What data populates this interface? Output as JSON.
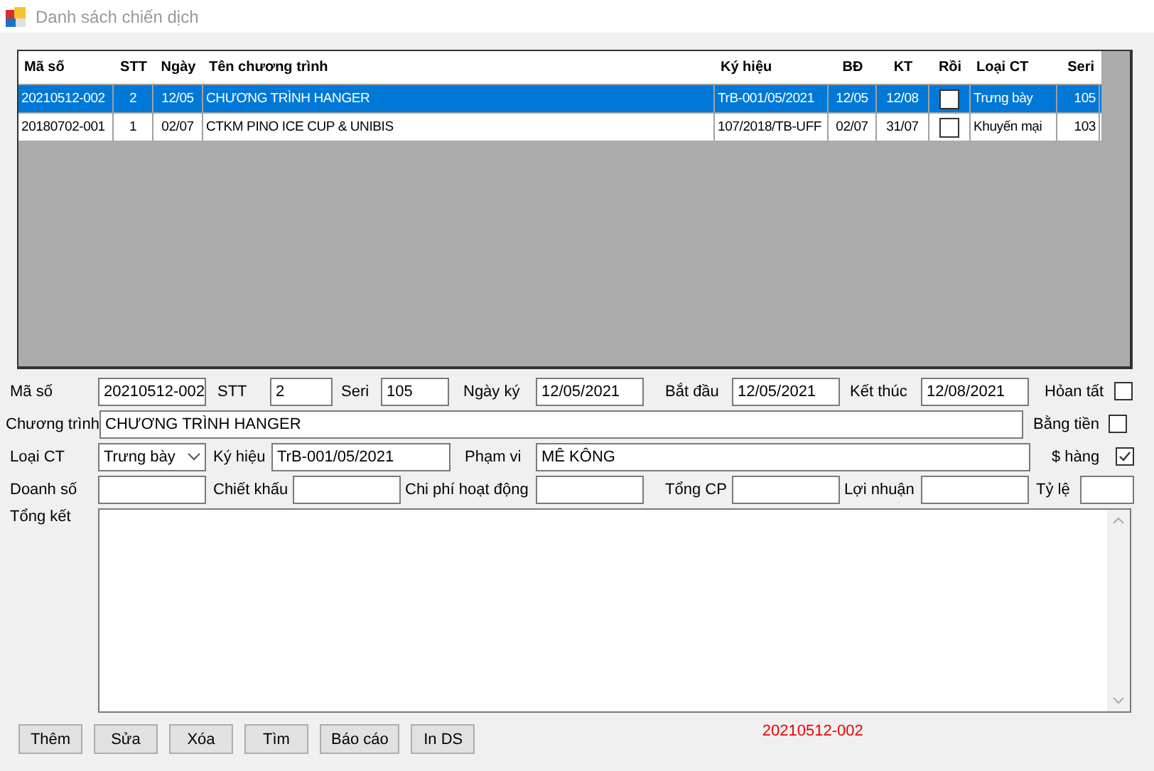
{
  "window": {
    "title": "Danh sách chiến dịch"
  },
  "table": {
    "columns": [
      "Mã số",
      "STT",
      "Ngày",
      "Tên chương trình",
      "Ký hiệu",
      "BĐ",
      "KT",
      "Rồi",
      "Loại CT",
      "Seri"
    ],
    "rows": [
      {
        "selected": true,
        "cells": [
          "20210512-002",
          "2",
          "12/05",
          "CHƯƠNG TRÌNH HANGER",
          "TrB-001/05/2021",
          "12/05",
          "12/08",
          false,
          "Trưng bày",
          "105"
        ]
      },
      {
        "selected": false,
        "cells": [
          "20180702-001",
          "1",
          "02/07",
          "CTKM PINO ICE CUP & UNIBIS",
          "107/2018/TB-UFF",
          "02/07",
          "31/07",
          false,
          "Khuyến mại",
          "103"
        ]
      }
    ]
  },
  "form": {
    "lines": [
      {
        "controls": [
          {
            "kind": "field",
            "label": "Mã số",
            "value": "20210512-002"
          },
          {
            "kind": "field",
            "label": "STT",
            "value": "2"
          },
          {
            "kind": "field",
            "label": "Seri",
            "value": "105"
          },
          {
            "kind": "field",
            "label": "Ngày ký",
            "value": "12/05/2021"
          },
          {
            "kind": "field",
            "label": "Bắt đầu",
            "value": "12/05/2021"
          },
          {
            "kind": "field",
            "label": "Kết thúc",
            "value": "12/08/2021"
          },
          {
            "kind": "check",
            "label": "Hỏan tất",
            "checked": false
          }
        ]
      },
      {
        "controls": [
          {
            "kind": "field",
            "label": "Chương trình",
            "value": "CHƯƠNG TRÌNH HANGER"
          },
          {
            "kind": "check",
            "label": "Bằng tiền",
            "checked": false
          }
        ]
      },
      {
        "controls": [
          {
            "kind": "combo",
            "label": "Loại CT",
            "value": "Trưng bày"
          },
          {
            "kind": "field",
            "label": "Ký hiệu",
            "value": "TrB-001/05/2021"
          },
          {
            "kind": "field",
            "label": "Phạm vi",
            "value": "MÊ KÔNG"
          },
          {
            "kind": "check",
            "label": "$ hàng",
            "checked": true
          }
        ]
      },
      {
        "controls": [
          {
            "kind": "field",
            "label": "Doanh số"
          },
          {
            "kind": "field",
            "label": "Chiết khấu"
          },
          {
            "kind": "field",
            "label": "Chi phí hoạt động"
          },
          {
            "kind": "field",
            "label": "Tổng CP"
          },
          {
            "kind": "field",
            "label": "Lợi nhuận"
          },
          {
            "kind": "field",
            "label": "Tỷ lệ"
          }
        ]
      }
    ],
    "summary_label": "Tổng kết"
  },
  "buttons": [
    "Thêm",
    "Sửa",
    "Xóa",
    "Tìm",
    "Báo cáo",
    "In DS"
  ],
  "status_code": "20210512-002"
}
